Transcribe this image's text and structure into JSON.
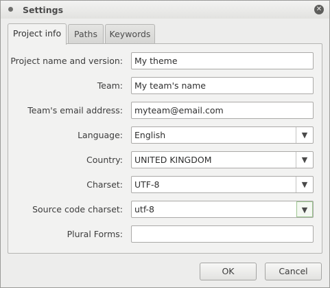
{
  "window": {
    "title": "Settings"
  },
  "tabs": [
    {
      "label": "Project info"
    },
    {
      "label": "Paths"
    },
    {
      "label": "Keywords"
    }
  ],
  "form": {
    "project_name": {
      "label": "Project name and version:",
      "value": "My theme"
    },
    "team": {
      "label": "Team:",
      "value": "My team's name"
    },
    "team_email": {
      "label": "Team's email address:",
      "value": "myteam@email.com"
    },
    "language": {
      "label": "Language:",
      "value": "English"
    },
    "country": {
      "label": "Country:",
      "value": "UNITED KINGDOM"
    },
    "charset": {
      "label": "Charset:",
      "value": "UTF-8"
    },
    "source_charset": {
      "label": "Source code charset:",
      "value": "utf-8"
    },
    "plural_forms": {
      "label": "Plural Forms:",
      "value": ""
    }
  },
  "buttons": {
    "ok": "OK",
    "cancel": "Cancel"
  },
  "icons": {
    "window_menu": "window-menu-icon",
    "close": "close-icon",
    "dropdown": "dropdown-arrow-icon"
  }
}
